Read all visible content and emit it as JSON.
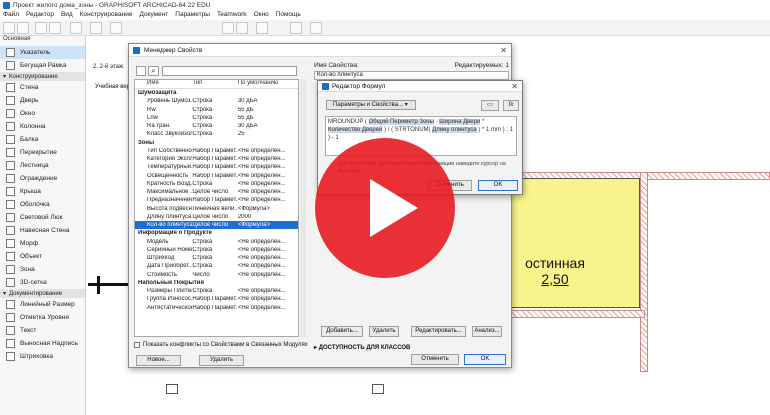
{
  "window": {
    "title": "Проект жилого дома_зоны - GRAPHISOFT ARCHICAD-64 22 EDU"
  },
  "menu": [
    "Файл",
    "Редактор",
    "Вид",
    "Конструирование",
    "Документ",
    "Параметры",
    "Teamwork",
    "Окно",
    "Помощь"
  ],
  "toolbox": {
    "tab": "Основная",
    "sections": [
      {
        "label": "",
        "items": [
          "Указатель",
          "Бегущая Рамка"
        ]
      },
      {
        "label": "Конструирование",
        "items": [
          "Стена",
          "Дверь",
          "Окно",
          "Колонна",
          "Балка",
          "Перекрытие",
          "Лестница",
          "Ограждение",
          "Крыша",
          "Оболочка",
          "Световой Люк",
          "Навесная Стена",
          "Морф",
          "Объект",
          "Зона",
          "3D-сетка"
        ]
      },
      {
        "label": "Документирование",
        "items": [
          "Линейный Размер",
          "Отметка Уровня",
          "Текст",
          "Выносная Надпись",
          "Штриховка"
        ]
      }
    ]
  },
  "plan": {
    "tab": "2. 2-й этаж.",
    "left_label": "Учебная верс",
    "room_name": "остинная",
    "room_area": "2,50"
  },
  "prop_manager": {
    "title": "Менеджер Свойств",
    "search_placeholder": "",
    "columns": [
      "Имя",
      "Тип",
      "По умолчанию"
    ],
    "rows": [
      {
        "group": true,
        "name": "Шумозащита"
      },
      {
        "name": "Уровень Шумоз...",
        "type": "Строка",
        "def": "30 дБА"
      },
      {
        "name": "Rw",
        "type": "Строка",
        "def": "55 дБ"
      },
      {
        "name": "Lnw",
        "type": "Строка",
        "def": "55 дБ"
      },
      {
        "name": "Ra тран.",
        "type": "Строка",
        "def": "30 дБА"
      },
      {
        "name": "Класс Звукоизол...",
        "type": "Строка",
        "def": "25"
      },
      {
        "group": true,
        "name": "Зоны"
      },
      {
        "name": "Тип Собственно...",
        "type": "Набор Парамет...",
        "def": "<Не определен..."
      },
      {
        "name": "Категория Экспл...",
        "type": "Набор Парамет...",
        "def": "<Не определен..."
      },
      {
        "name": "Температурный...",
        "type": "Набор Парамет...",
        "def": "<Не определен..."
      },
      {
        "name": "Освещенность",
        "type": "Набор Парамет...",
        "def": "<Не определен..."
      },
      {
        "name": "Кратность Возд...",
        "type": "Строка",
        "def": "<Не определен..."
      },
      {
        "name": "Максимальное ...",
        "type": "Целое число",
        "def": "<Не определен..."
      },
      {
        "name": "Предназначение",
        "type": "Набор Парамет...",
        "def": "<Не определен..."
      },
      {
        "name": "Высота подвесн...",
        "type": "Линейная вели...",
        "def": "<Формула>"
      },
      {
        "name": "Длину плинтуса",
        "type": "Целое число",
        "def": "2000"
      },
      {
        "name": "Кол-во плинтуса",
        "type": "Целое число",
        "def": "<Формула>",
        "selected": true
      },
      {
        "group": true,
        "name": "Информация о Продукте"
      },
      {
        "name": "Модель",
        "type": "Строка",
        "def": "<Не определен..."
      },
      {
        "name": "Серийный Номер",
        "type": "Строка",
        "def": "<Не определен..."
      },
      {
        "name": "Штрихкод",
        "type": "Строка",
        "def": "<Не определен..."
      },
      {
        "name": "Дата Приобрет...",
        "type": "Строка",
        "def": "<Не определен..."
      },
      {
        "name": "Стоимость",
        "type": "Число",
        "def": "<Не определен..."
      },
      {
        "group": true,
        "name": "Напольные Покрытия"
      },
      {
        "name": "Размеры Плитки",
        "type": "Строка",
        "def": "<Не определен..."
      },
      {
        "name": "Группа Износос...",
        "type": "Набор Парамет...",
        "def": "<Не определен..."
      },
      {
        "name": "Антистатическое...",
        "type": "Набор Парамет...",
        "def": "<Не определен..."
      }
    ],
    "conflicts_label": "Показать конфликты со Свойствами в Связанных Модулях",
    "new_button": "Новое...",
    "delete_button": "Удалить",
    "prop_name_label": "Имя Свойства:",
    "editable_label": "Редактируемых: 1",
    "prop_name_value": "Кол-во плинтуса",
    "action_buttons": [
      "Добавить...",
      "Удалить",
      "Редактировать...",
      "Анализ..."
    ],
    "access_label": "ДОСТУПНОСТЬ ДЛЯ КЛАССОВ",
    "cancel_button": "Отменить",
    "ok_button": "OK"
  },
  "formula_editor": {
    "title": "Редактор Формул",
    "params_dropdown": "Параметры и Свойства...",
    "fx_label": "fx",
    "formula_pre": "MROUNDUP ( ",
    "formula_hl1": "Общий Периметр Зоны",
    "formula_mid1": " - ",
    "formula_hl2": "Ширина Двери",
    "formula_mid2": " * ",
    "formula_hl3": "Количество Дверей",
    "formula_mid3": " ) / ( STRTONUM( ",
    "formula_hl4": "Длину плинтуса",
    "formula_post": " ) * 1 mm ) ; 1 ) - 1",
    "hint": "Для получения дополнительной информации наведите курсор на функцию.",
    "cancel_button": "Отменить",
    "ok_button": "OK"
  },
  "video": {
    "play_icon": "play-icon"
  }
}
